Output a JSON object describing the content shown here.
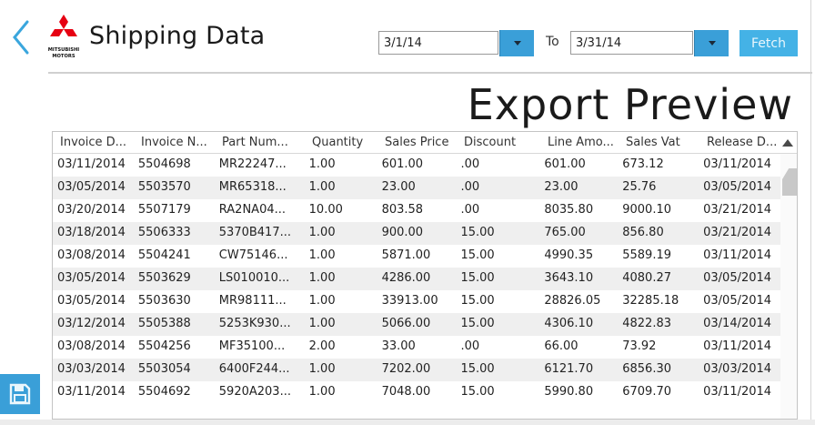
{
  "header": {
    "app_title": "Shipping Data",
    "logo_text": "MITSUBISHI MOTORS",
    "from_date": "3/1/14",
    "to_label": "To",
    "to_date": "3/31/14",
    "fetch_label": "Fetch"
  },
  "preview": {
    "title": "Export Preview"
  },
  "table": {
    "columns": [
      "Invoice D...",
      "Invoice N...",
      "Part Num...",
      "Quantity",
      "Sales Price",
      "Discount",
      "Line Amo...",
      "Sales Vat",
      "Release D..."
    ],
    "rows": [
      [
        "03/11/2014",
        "5504698",
        "MR22247...",
        "1.00",
        "601.00",
        ".00",
        "601.00",
        "673.12",
        "03/11/2014"
      ],
      [
        "03/05/2014",
        "5503570",
        "MR65318...",
        "1.00",
        "23.00",
        ".00",
        "23.00",
        "25.76",
        "03/05/2014"
      ],
      [
        "03/20/2014",
        "5507179",
        "RA2NA04...",
        "10.00",
        "803.58",
        ".00",
        "8035.80",
        "9000.10",
        "03/21/2014"
      ],
      [
        "03/18/2014",
        "5506333",
        "5370B417...",
        "1.00",
        "900.00",
        "15.00",
        "765.00",
        "856.80",
        "03/21/2014"
      ],
      [
        "03/08/2014",
        "5504241",
        "CW75146...",
        "1.00",
        "5871.00",
        "15.00",
        "4990.35",
        "5589.19",
        "03/11/2014"
      ],
      [
        "03/05/2014",
        "5503629",
        "LS010010...",
        "1.00",
        "4286.00",
        "15.00",
        "3643.10",
        "4080.27",
        "03/05/2014"
      ],
      [
        "03/05/2014",
        "5503630",
        "MR98111...",
        "1.00",
        "33913.00",
        "15.00",
        "28826.05",
        "32285.18",
        "03/05/2014"
      ],
      [
        "03/12/2014",
        "5505388",
        "5253K930...",
        "1.00",
        "5066.00",
        "15.00",
        "4306.10",
        "4822.83",
        "03/14/2014"
      ],
      [
        "03/08/2014",
        "5504256",
        "MF35100...",
        "2.00",
        "33.00",
        ".00",
        "66.00",
        "73.92",
        "03/11/2014"
      ],
      [
        "03/03/2014",
        "5503054",
        "6400F244...",
        "1.00",
        "7202.00",
        "15.00",
        "6121.70",
        "6856.30",
        "03/03/2014"
      ],
      [
        "03/11/2014",
        "5504692",
        "5920A203...",
        "1.00",
        "7048.00",
        "15.00",
        "5990.80",
        "6709.70",
        "03/11/2014"
      ]
    ]
  },
  "icons": {
    "back": "chevron-left-icon",
    "logo": "mitsubishi-logo",
    "dropdown": "caret-down-icon",
    "save": "floppy-disk-icon"
  },
  "colors": {
    "accent": "#3a9fd8",
    "fetch": "#44b2e6",
    "logo_red": "#e60012"
  }
}
